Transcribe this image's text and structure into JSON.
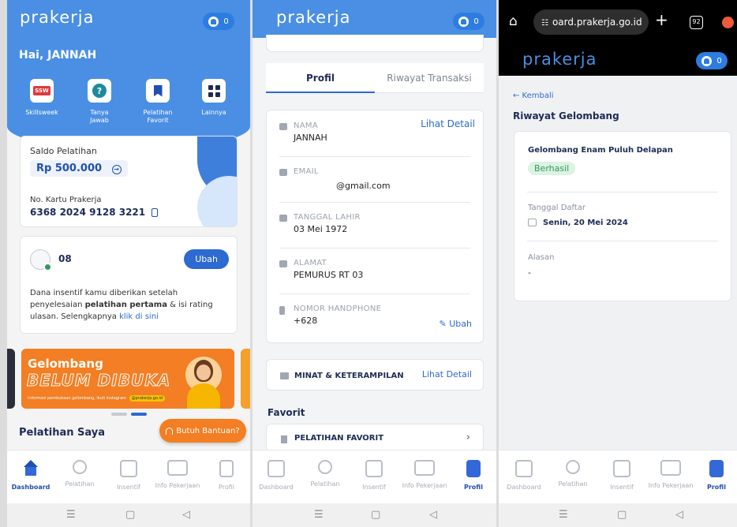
{
  "p1": {
    "logo": "prakerja",
    "notif_count": "0",
    "greeting": "Hai, JANNAH",
    "quick": [
      {
        "label": "Skillsweek",
        "icon": "skillsweek-icon"
      },
      {
        "label": "Tanya Jawab",
        "icon": "question-icon"
      },
      {
        "label": "Pelatihan Favorit",
        "icon": "bookmark-icon"
      },
      {
        "label": "Lainnya",
        "icon": "grid-icon"
      }
    ],
    "saldo_label": "Saldo Pelatihan",
    "saldo_value": "Rp 500.000",
    "kartu_label": "No. Kartu Prakerja",
    "kartu_number": "6368 2024 9128 3221",
    "phone_partial": "08",
    "ubah": "Ubah",
    "insentif_text_1": "Dana insentif kamu diberikan setelah penyelesaian",
    "insentif_bold": "pelatihan pertama",
    "insentif_text_2": "& isi rating ulasan.",
    "insentif_text_3": "Selengkapnya",
    "insentif_link": "klik di sini",
    "banner_title": "Gelombang",
    "banner_big": "BELUM DIBUKA",
    "banner_sub": "Informasi pembukaan gelombang, ikuti instagram",
    "banner_tag": "@prakerja.go.id",
    "section_title": "Pelatihan Saya",
    "help_button": "Butuh Bantuan?"
  },
  "p2": {
    "logo": "prakerja",
    "notif_count": "0",
    "tabs": [
      "Profil",
      "Riwayat Transaksi"
    ],
    "lihat_detail": "Lihat Detail",
    "fields": [
      {
        "label": "NAMA",
        "value": "JANNAH"
      },
      {
        "label": "EMAIL",
        "value": "@gmail.com"
      },
      {
        "label": "TANGGAL LAHIR",
        "value": "03 Mei 1972"
      },
      {
        "label": "ALAMAT",
        "value": "PEMURUS RT 03"
      },
      {
        "label": "NOMOR HANDPHONE",
        "value": "+628"
      }
    ],
    "ubah": "Ubah",
    "minat": "MINAT & KETERAMPILAN",
    "minat_link": "Lihat Detail",
    "favorit_title": "Favorit",
    "pelatihan_favorit": "PELATIHAN FAVORIT"
  },
  "p3": {
    "url": "oard.prakerja.go.id",
    "tab_count": "92",
    "logo": "prakerja",
    "notif_count": "0",
    "back": "← Kembali",
    "title": "Riwayat Gelombang",
    "gelombang_name": "Gelombang Enam Puluh Delapan",
    "status": "Berhasil",
    "tanggal_label": "Tanggal Daftar",
    "tanggal_value": "Senin, 20 Mei 2024",
    "alasan_label": "Alasan",
    "alasan_value": "-"
  },
  "nav": [
    "Dashboard",
    "Pelatihan",
    "Insentif",
    "Info Pekerjaan",
    "Profil"
  ],
  "colors": {
    "brand_blue": "#4a8fe4",
    "dark_blue": "#1f4fb0",
    "success": "#2f9c5a",
    "orange": "#f37e23"
  }
}
